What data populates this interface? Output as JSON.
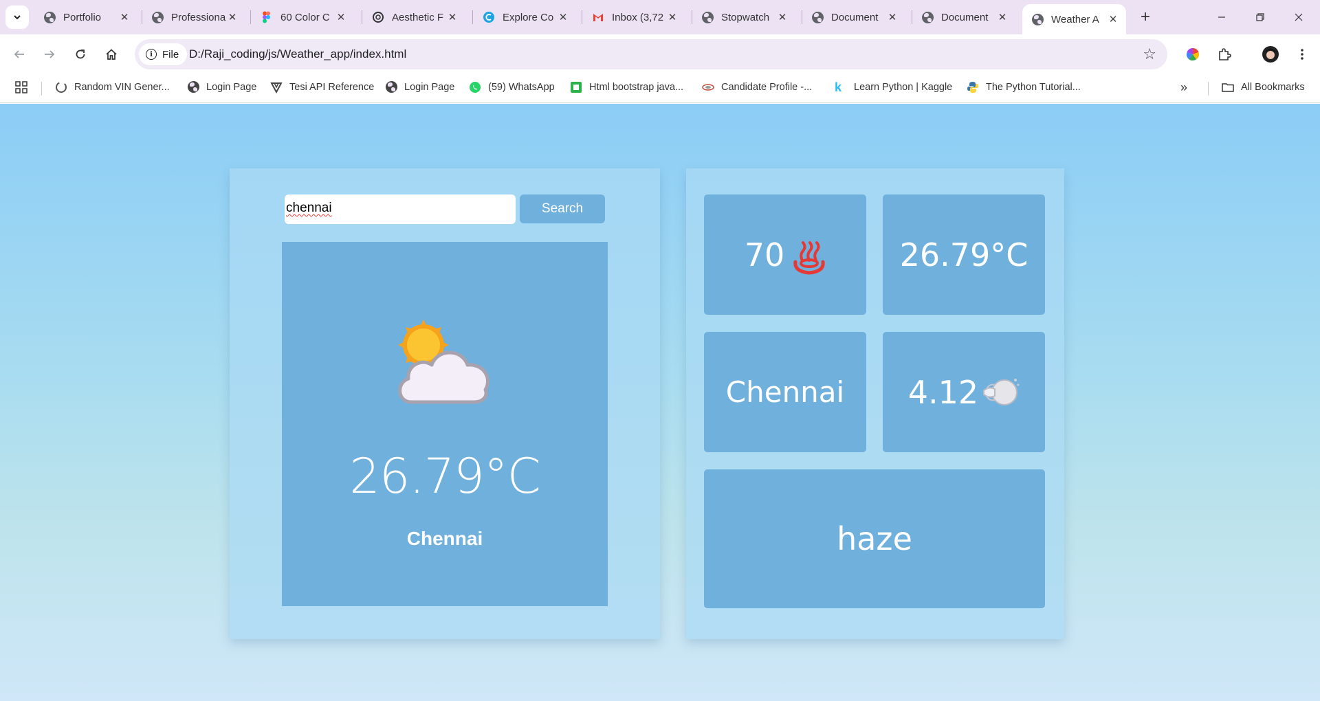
{
  "browser": {
    "tabs": [
      {
        "title": "Portfolio",
        "icon": "globe-icon"
      },
      {
        "title": "Professional",
        "icon": "globe-icon"
      },
      {
        "title": "60 Color C",
        "icon": "figma-icon"
      },
      {
        "title": "Aesthetic F",
        "icon": "openai-icon"
      },
      {
        "title": "Explore Co",
        "icon": "canva-icon"
      },
      {
        "title": "Inbox (3,72",
        "icon": "gmail-icon"
      },
      {
        "title": "Stopwatch",
        "icon": "globe-icon"
      },
      {
        "title": "Document",
        "icon": "globe-icon"
      },
      {
        "title": "Document",
        "icon": "globe-icon"
      },
      {
        "title": "Weather A",
        "icon": "globe-icon",
        "active": true
      }
    ],
    "site_chip": "File",
    "url": "D:/Raji_coding/js/Weather_app/index.html",
    "bookmarks": [
      {
        "label": "Random VIN Gener...",
        "icon": "spinner-icon"
      },
      {
        "label": "Login Page",
        "icon": "globe-icon"
      },
      {
        "label": "Tesi API Reference",
        "icon": "tesi-icon"
      },
      {
        "label": "Login Page",
        "icon": "globe-icon"
      },
      {
        "label": "(59) WhatsApp",
        "icon": "whatsapp-icon"
      },
      {
        "label": "Html bootstrap java...",
        "icon": "green-square-icon"
      },
      {
        "label": "Candidate Profile -...",
        "icon": "candidate-icon"
      },
      {
        "label": "Learn Python | Kaggle",
        "icon": "kaggle-icon"
      },
      {
        "label": "The Python Tutorial...",
        "icon": "python-icon"
      }
    ],
    "all_bookmarks": "All Bookmarks"
  },
  "app": {
    "search": {
      "value": "chennai",
      "button": "Search"
    },
    "main": {
      "temperature": "26.79°C",
      "city": "Chennai",
      "icon": "partly-cloudy-icon"
    },
    "tiles": {
      "humidity": {
        "value": "70",
        "icon": "hot-springs-icon"
      },
      "temperature": {
        "value": "26.79°C"
      },
      "city": {
        "value": "Chennai"
      },
      "wind": {
        "value": "4.12",
        "icon": "wind-face-icon"
      },
      "description": {
        "value": "haze"
      }
    }
  },
  "colors": {
    "card": "#70b0dc",
    "page_top": "#8ccdf6",
    "page_bottom": "#cfe7f8",
    "tab_strip": "#ece2f3"
  }
}
